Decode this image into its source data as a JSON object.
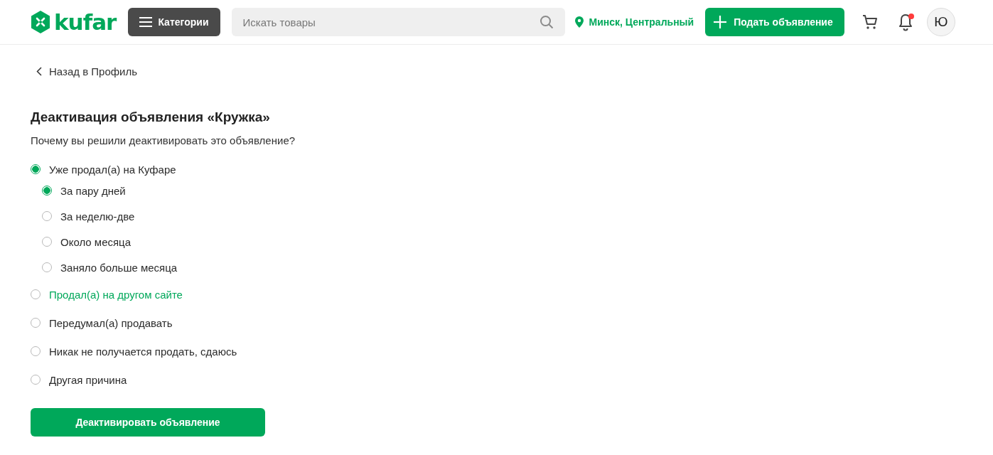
{
  "header": {
    "logo": "kufar",
    "categories_button": "Категории",
    "search": {
      "placeholder": "Искать товары"
    },
    "location": "Минск, Центральный",
    "post_button": "Подать объявление",
    "notifications": {
      "unread": true
    },
    "avatar": "Ю"
  },
  "back_link": "Назад в Профиль",
  "title": "Деактивация объявления «Кружка»",
  "question": "Почему вы решили деактивировать это объявление?",
  "reasons": [
    {
      "label": "Уже продал(а) на Куфаре",
      "selected": true,
      "hovered": false,
      "children": [
        {
          "label": "За пару дней",
          "selected": true
        },
        {
          "label": "За неделю-две",
          "selected": false
        },
        {
          "label": "Около месяца",
          "selected": false
        },
        {
          "label": "Заняло больше месяца",
          "selected": false
        }
      ]
    },
    {
      "label": "Продал(а) на другом сайте",
      "selected": false,
      "hovered": true
    },
    {
      "label": "Передумал(а) продавать",
      "selected": false,
      "hovered": false
    },
    {
      "label": "Никак не получается продать, сдаюсь",
      "selected": false,
      "hovered": false
    },
    {
      "label": "Другая причина",
      "selected": false,
      "hovered": false
    }
  ],
  "submit_button": "Деактивировать объявление"
}
